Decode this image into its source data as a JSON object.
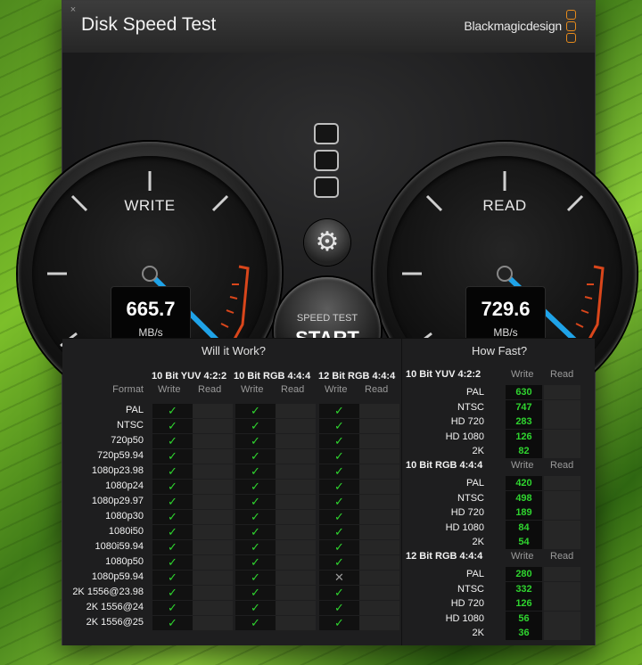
{
  "window": {
    "title": "Disk Speed Test",
    "brand": "Blackmagicdesign",
    "close_glyph": "×"
  },
  "gauges": {
    "write": {
      "label": "WRITE",
      "value": "665.7",
      "unit": "MB/s"
    },
    "read": {
      "label": "READ",
      "value": "729.6",
      "unit": "MB/s"
    }
  },
  "controls": {
    "gear_icon": "settings-gear-icon",
    "start_small": "SPEED TEST",
    "start_big": "START"
  },
  "will_it_work": {
    "title": "Will it Work?",
    "format_header": "Format",
    "groups": [
      "10 Bit YUV 4:2:2",
      "10 Bit RGB 4:4:4",
      "12 Bit RGB 4:4:4"
    ],
    "write_label": "Write",
    "read_label": "Read",
    "rows": [
      {
        "name": "PAL",
        "w": [
          "ok",
          "ok",
          "ok"
        ]
      },
      {
        "name": "NTSC",
        "w": [
          "ok",
          "ok",
          "ok"
        ]
      },
      {
        "name": "720p50",
        "w": [
          "ok",
          "ok",
          "ok"
        ]
      },
      {
        "name": "720p59.94",
        "w": [
          "ok",
          "ok",
          "ok"
        ]
      },
      {
        "name": "1080p23.98",
        "w": [
          "ok",
          "ok",
          "ok"
        ]
      },
      {
        "name": "1080p24",
        "w": [
          "ok",
          "ok",
          "ok"
        ]
      },
      {
        "name": "1080p29.97",
        "w": [
          "ok",
          "ok",
          "ok"
        ]
      },
      {
        "name": "1080p30",
        "w": [
          "ok",
          "ok",
          "ok"
        ]
      },
      {
        "name": "1080i50",
        "w": [
          "ok",
          "ok",
          "ok"
        ]
      },
      {
        "name": "1080i59.94",
        "w": [
          "ok",
          "ok",
          "ok"
        ]
      },
      {
        "name": "1080p50",
        "w": [
          "ok",
          "ok",
          "ok"
        ]
      },
      {
        "name": "1080p59.94",
        "w": [
          "ok",
          "ok",
          "no"
        ]
      },
      {
        "name": "2K 1556@23.98",
        "w": [
          "ok",
          "ok",
          "ok"
        ]
      },
      {
        "name": "2K 1556@24",
        "w": [
          "ok",
          "ok",
          "ok"
        ]
      },
      {
        "name": "2K 1556@25",
        "w": [
          "ok",
          "ok",
          "ok"
        ]
      }
    ],
    "ok_glyph": "✓",
    "no_glyph": "✕"
  },
  "how_fast": {
    "title": "How Fast?",
    "write_label": "Write",
    "read_label": "Read",
    "groups": [
      {
        "name": "10 Bit YUV 4:2:2",
        "rows": [
          {
            "name": "PAL",
            "write": "630"
          },
          {
            "name": "NTSC",
            "write": "747"
          },
          {
            "name": "HD 720",
            "write": "283"
          },
          {
            "name": "HD 1080",
            "write": "126"
          },
          {
            "name": "2K",
            "write": "82"
          }
        ]
      },
      {
        "name": "10 Bit RGB 4:4:4",
        "rows": [
          {
            "name": "PAL",
            "write": "420"
          },
          {
            "name": "NTSC",
            "write": "498"
          },
          {
            "name": "HD 720",
            "write": "189"
          },
          {
            "name": "HD 1080",
            "write": "84"
          },
          {
            "name": "2K",
            "write": "54"
          }
        ]
      },
      {
        "name": "12 Bit RGB 4:4:4",
        "rows": [
          {
            "name": "PAL",
            "write": "280"
          },
          {
            "name": "NTSC",
            "write": "332"
          },
          {
            "name": "HD 720",
            "write": "126"
          },
          {
            "name": "HD 1080",
            "write": "56"
          },
          {
            "name": "2K",
            "write": "36"
          }
        ]
      }
    ]
  },
  "colors": {
    "accent": "#e78b1c",
    "needle": "#1fa3e8",
    "ok": "#2fd42f",
    "redzone": "#d9461b"
  }
}
